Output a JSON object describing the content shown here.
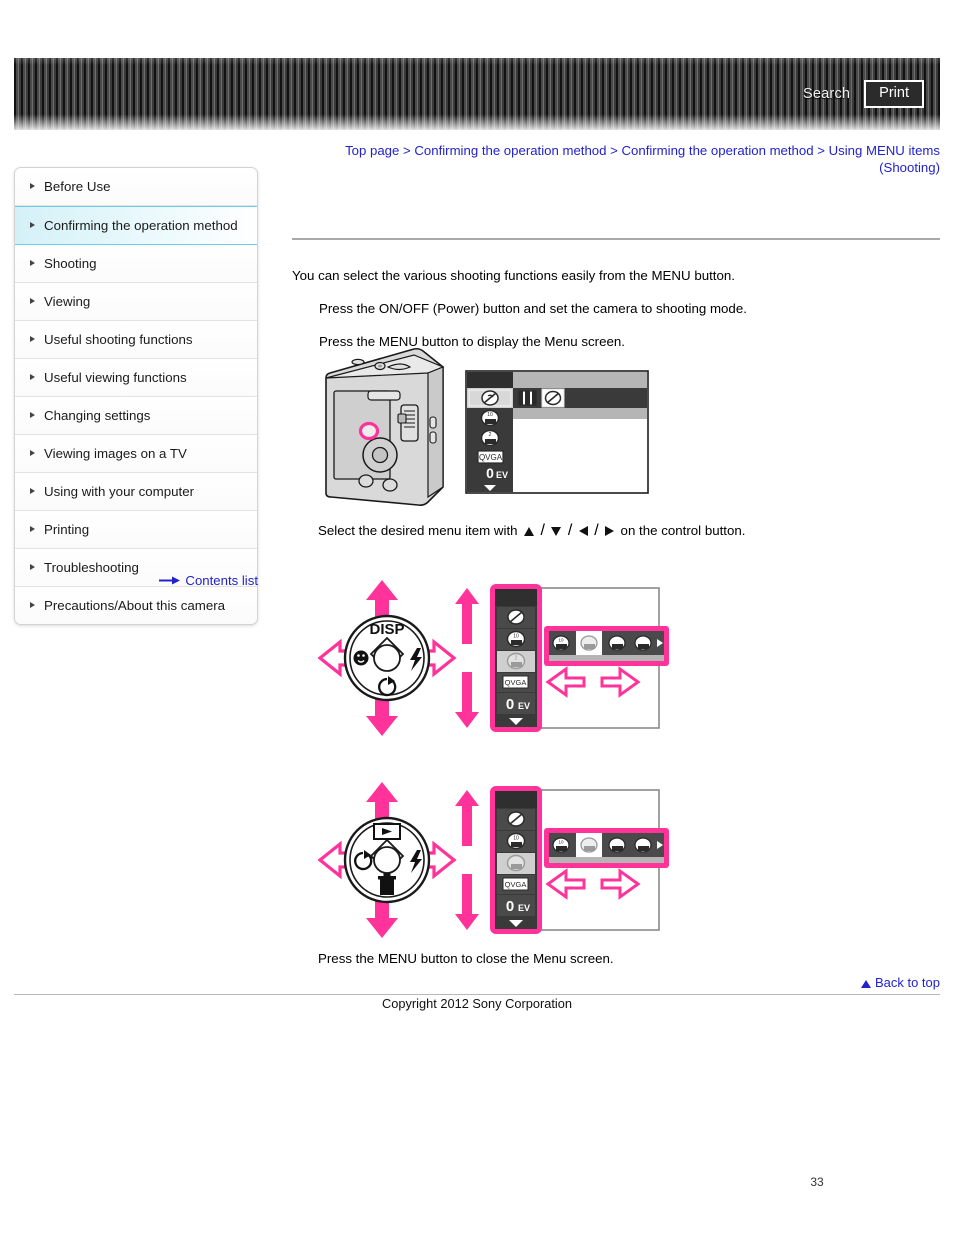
{
  "header": {
    "search_label": "Search",
    "print_label": "Print",
    "search_icon": "search-icon",
    "print_icon": "print-icon"
  },
  "breadcrumb": {
    "separator": ">",
    "items": [
      "Top page",
      "Confirming the operation method",
      "Confirming the operation method",
      "Using MENU items (Shooting)"
    ]
  },
  "sidebar": {
    "items": [
      {
        "label": "Before Use",
        "active": false
      },
      {
        "label": "Confirming the operation method",
        "active": true
      },
      {
        "label": "Shooting",
        "active": false
      },
      {
        "label": "Viewing",
        "active": false
      },
      {
        "label": "Useful shooting functions",
        "active": false
      },
      {
        "label": "Useful viewing functions",
        "active": false
      },
      {
        "label": "Changing settings",
        "active": false
      },
      {
        "label": "Viewing images on a TV",
        "active": false
      },
      {
        "label": "Using with your computer",
        "active": false
      },
      {
        "label": "Printing",
        "active": false
      },
      {
        "label": "Troubleshooting",
        "active": false
      },
      {
        "label": "Precautions/About this camera",
        "active": false
      }
    ],
    "contents_list_label": "Contents list",
    "contents_list_icon": "arrow-right-icon"
  },
  "main": {
    "intro": "You can select the various shooting functions easily from the MENU button.",
    "step_1": "Press the ON/OFF (Power) button and set the camera to shooting mode.",
    "step_2": "Press the MENU button to display the Menu screen.",
    "step_3_prefix": "Select the desired menu item with",
    "step_3_suffix": "on the control button.",
    "step_3_sep": "/",
    "step_4": "Press the MENU button to close the Menu screen."
  },
  "figures": {
    "figure_1": {
      "name": "camera-menu-button-illustration",
      "camera_alt": "camera-rear-illustration",
      "highlight_color": "#ff3399",
      "menu_screen": {
        "left_column_icons": [
          "scene-selection-icon",
          "smile-shutter-icon",
          "self-timer-icon",
          "image-size-vga-icon",
          "exposure-0ev-icon",
          "scroll-down-icon"
        ],
        "left_column_labels": [
          "",
          "",
          "",
          "QVGA",
          "0EV",
          ""
        ],
        "top_row_icons": [
          "movie-mode-icon",
          "scene-selection-icon"
        ]
      }
    },
    "figure_2": {
      "name": "control-button-disp-diagram",
      "center_label": "DISP",
      "up_label": "DISP",
      "left_icon": "smile-shutter-icon",
      "right_icon": "flash-icon",
      "down_icon": "self-timer-icon",
      "arrow_color": "#ff3399",
      "menu_rows": [
        "scene-selection-icon",
        "smile-shutter-icon",
        "self-timer-icon",
        "QVGA",
        "0EV",
        "scroll-down-icon"
      ],
      "menu_bar_icons": [
        "self-timer-10sec-icon",
        "self-timer-2sec-icon",
        "self-timer-off-icon",
        "self-timer-portrait-icon"
      ],
      "menu_bar_more": "more-right-icon"
    },
    "figure_3": {
      "name": "control-button-playback-diagram",
      "up_icon": "playback-icon",
      "left_icon": "self-timer-icon",
      "right_icon": "flash-icon",
      "down_icon": "delete-trash-icon",
      "arrow_color": "#ff3399",
      "menu_rows": [
        "scene-selection-icon",
        "smile-shutter-icon",
        "self-timer-icon",
        "QVGA",
        "0EV",
        "scroll-down-icon"
      ],
      "menu_bar_icons": [
        "self-timer-10sec-icon",
        "self-timer-2sec-icon",
        "self-timer-off-icon",
        "self-timer-portrait-icon"
      ],
      "menu_bar_more": "more-right-icon"
    }
  },
  "footer": {
    "back_to_top_label": "Back to top",
    "back_to_top_icon": "triangle-up-icon",
    "copyright": "Copyright 2012 Sony Corporation",
    "page_number": "33"
  },
  "colors": {
    "link": "#2222cc",
    "accent_pink": "#ff3399",
    "sidebar_active": "#d4f1f7",
    "header_dark": "#3a3a3a"
  }
}
